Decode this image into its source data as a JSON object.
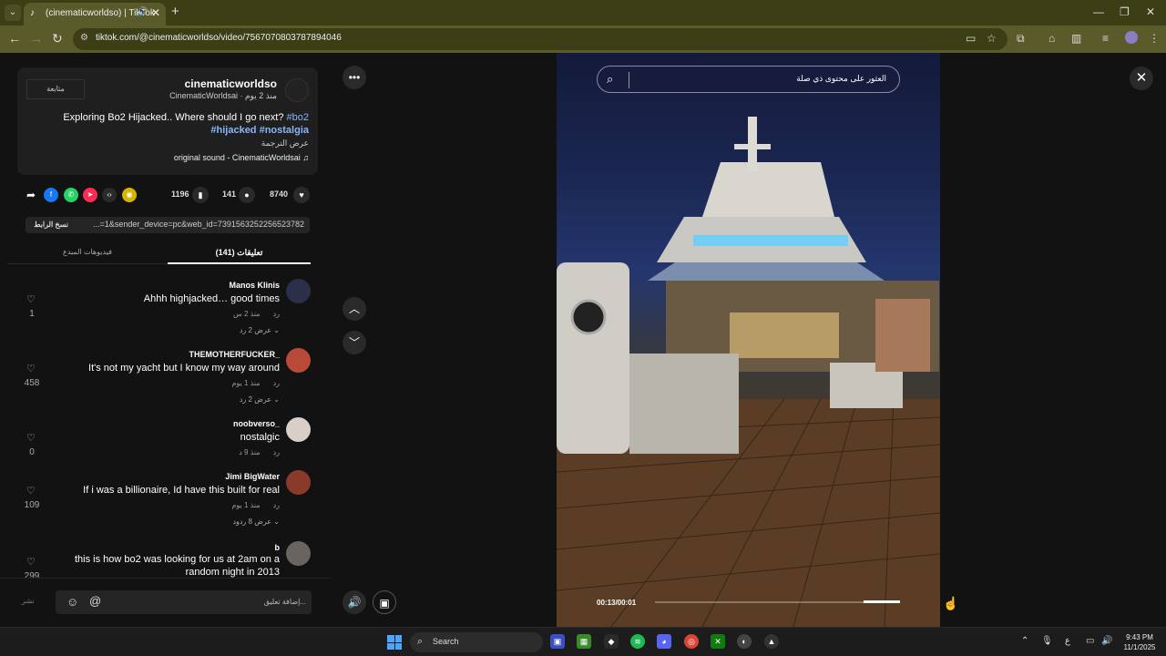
{
  "browser": {
    "tab_title": "(cinematicworldso) | TikTok",
    "url": "tiktok.com/@cinematicworldso/video/7567070803787894046"
  },
  "author": {
    "name": "cinematicworldso",
    "meta": "CinematicWorldsai · منذ 2 يوم",
    "follow_label": "متابعة"
  },
  "description": {
    "line1_text": "Exploring Bo2 Hijacked.. Where should I go next? ",
    "line1_tag": "#bo2",
    "line2": "#hijacked #nostalgia",
    "translate": "عرض الترجمة",
    "sound": "original sound - CinematicWorldsai ♫"
  },
  "stats": {
    "likes": "8740",
    "comments": "141",
    "saves": "1196"
  },
  "share": {
    "copy_label": "نسخ الرابط",
    "link": "...=1&sender_device=pc&web_id=7391563252256523782"
  },
  "tabs": {
    "comments": "(141) تعليقات",
    "creator_videos": "فيديوهات المبدع"
  },
  "comments": [
    {
      "user": "Manos Klinis",
      "text": "Ahhh highjacked… good times",
      "time": "منذ 2 س",
      "reply": "رد",
      "replies": "عرض 2 رد ⌄",
      "likes": "1",
      "avatar_color": "#2b2f4a"
    },
    {
      "user": "THEMOTHERFUCKER_",
      "text": "It's not my yacht but I know my way around",
      "time": "منذ 1 يوم",
      "reply": "رد",
      "replies": "عرض 2 رد ⌄",
      "likes": "458",
      "avatar_color": "#b84a3a"
    },
    {
      "user": "noobverso_",
      "text": "nostalgic",
      "time": "منذ 9 د",
      "reply": "رد",
      "replies": "",
      "likes": "0",
      "avatar_color": "#d8cfc8"
    },
    {
      "user": "Jimi BigWater",
      "text": "If i was a billionaire, Id have this built for real",
      "time": "منذ 1 يوم",
      "reply": "رد",
      "replies": "عرض 8 ردود ⌄",
      "likes": "109",
      "avatar_color": "#8a3a2a"
    },
    {
      "user": "b",
      "text": "this is how bo2 was looking for us at 2am on a",
      "text2": "random night in 2013",
      "time": "",
      "reply": "",
      "replies": "",
      "likes": "299",
      "avatar_color": "#6a6460"
    }
  ],
  "composer": {
    "placeholder": "إضافة تعليق...",
    "post": "نشر"
  },
  "video": {
    "search_text": "العثور على محتوى ذي صلة",
    "time": "00:13/00:01",
    "progress": 0.15
  },
  "taskbar": {
    "search": "Search",
    "time": "9:43 PM",
    "date": "11/1/2025",
    "lang": "ع"
  },
  "colors": {
    "browser_frame": "#595c2a",
    "tag_link": "#8ab4f8",
    "like_red": "#fe2c55"
  }
}
